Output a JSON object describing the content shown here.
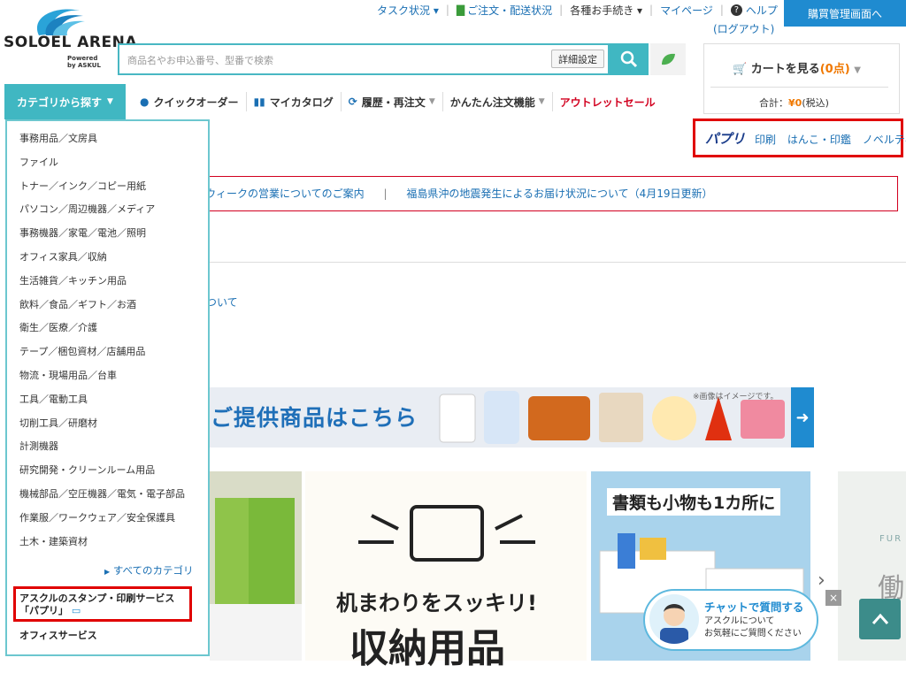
{
  "logo": {
    "name": "SOLOEL ARENA",
    "sub1": "Powered",
    "sub2": "by ASKUL"
  },
  "toplinks": {
    "task": "タスク状況 ▾",
    "orders": "ご注文・配送状況",
    "procedures": "各種お手続き ▾",
    "mypage": "マイページ",
    "help": "ヘルプ",
    "logout": "(ログアウト)",
    "management": "購買管理画面へ"
  },
  "search": {
    "placeholder": "商品名やお申込番号、型番で検索",
    "advanced": "詳細設定"
  },
  "cart": {
    "title": "カートを見る",
    "count": "(0点)",
    "total_label": "合計：",
    "total_value": "¥0",
    "tax": "(税込)"
  },
  "nav": {
    "category": "カテゴリから探す",
    "quick_order": "クイックオーダー",
    "my_catalog": "マイカタログ",
    "history": "履歴・再注文",
    "easy_order": "かんたん注文機能",
    "outlet": "アウトレットセール"
  },
  "categories": [
    "事務用品／文房具",
    "ファイル",
    "トナー／インク／コピー用紙",
    "パソコン／周辺機器／メディア",
    "事務機器／家電／電池／照明",
    "オフィス家具／収納",
    "生活雑貨／キッチン用品",
    "飲料／食品／ギフト／お酒",
    "衛生／医療／介護",
    "テープ／梱包資材／店舗用品",
    "物流・現場用品／台車",
    "工具／電動工具",
    "切削工具／研磨材",
    "計測機器",
    "研究開発・クリーンルーム用品",
    "機械部品／空圧機器／電気・電子部品",
    "作業服／ワークウェア／安全保護具",
    "土木・建築資材"
  ],
  "all_categories": "すべてのカテゴリ",
  "papuri_service_line1": "アスクルのスタンプ・印刷サービス",
  "papuri_service_line2": "「パプリ」",
  "office_service": "オフィスサービス",
  "partner": {
    "logo": "パプリ",
    "print": "印刷",
    "stamp": "はんこ・印鑑",
    "novelty": "ノベルティ"
  },
  "notices": [
    "ウィークの営業についてのご案内",
    "福島県沖の地震発生によるお届け状況について（4月19日更新）"
  ],
  "notice_sep": "|",
  "tsuite": "ついて",
  "banner": {
    "text": "ご提供商品はこちら",
    "note": "※画像はイメージです。"
  },
  "slides": {
    "s3_title": "書類も小物も1カ所に",
    "s2_line1": "机まわりをスッキリ!",
    "s2_line2": "収納用品",
    "s4_text": "FUR",
    "s4_big": "働"
  },
  "chat": {
    "title": "チャットで質問する",
    "sub1": "アスクルについて",
    "sub2": "お気軽にご質問ください",
    "close": "×"
  }
}
